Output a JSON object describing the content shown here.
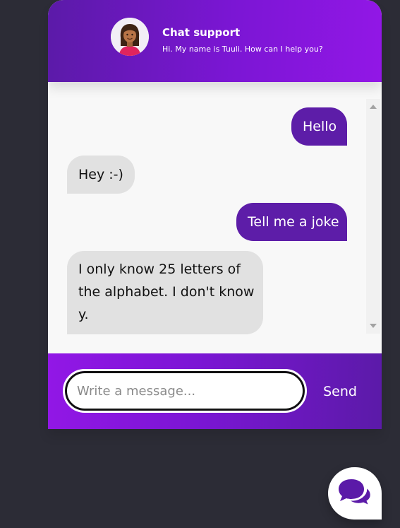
{
  "header": {
    "title": "Chat support",
    "subtitle": "Hi. My name is Tuuli. How can I help you?"
  },
  "messages": [
    {
      "sender": "operator",
      "text": "Hello"
    },
    {
      "sender": "visitor",
      "text": "Hey :-)"
    },
    {
      "sender": "operator",
      "text": "Tell me a joke"
    },
    {
      "sender": "visitor",
      "text": "I only know 25 letters of the alphabet. I don't know y."
    }
  ],
  "footer": {
    "input_placeholder": "Write a message...",
    "send_label": "Send"
  },
  "colors": {
    "primary_dark": "#5b1aa8",
    "primary_light": "#9217e6",
    "visitor_bubble": "#e1e1e1",
    "background": "#2c2c36"
  },
  "icons": {
    "avatar": "support-agent-avatar",
    "launcher": "chat-bubbles-icon"
  }
}
